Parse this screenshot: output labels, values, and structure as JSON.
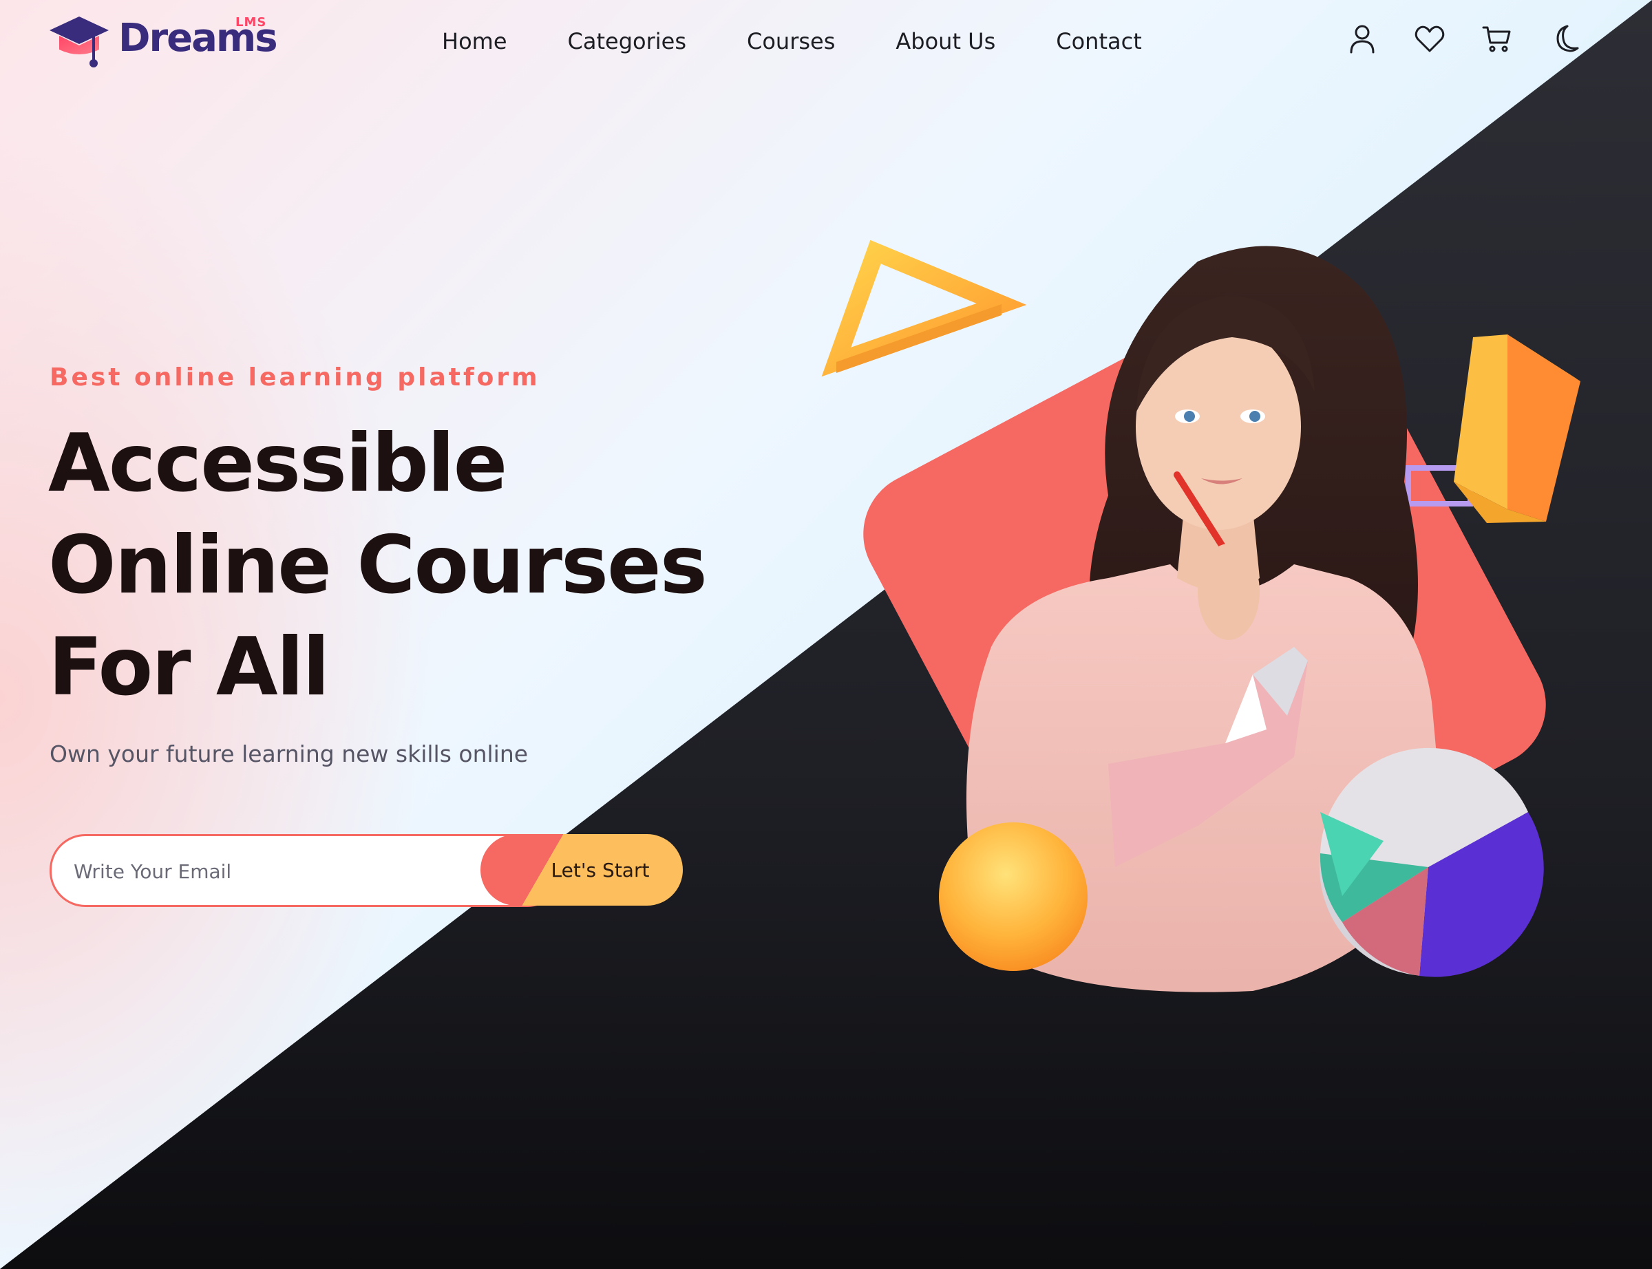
{
  "brand": {
    "name": "Dreams",
    "suffix": "LMS"
  },
  "nav": {
    "items": [
      "Home",
      "Categories",
      "Courses",
      "About Us",
      "Contact"
    ]
  },
  "header_icons": [
    "user-icon",
    "heart-icon",
    "cart-icon",
    "moon-icon"
  ],
  "hero": {
    "tagline": "Best online learning platform",
    "headline": [
      "Accessible",
      "Online Courses",
      "For All"
    ],
    "subtitle": "Own your future learning new skills online",
    "email_placeholder": "Write Your Email",
    "cta_label": "Let's Start"
  },
  "colors": {
    "brand_purple": "#392c7d",
    "accent_coral": "#f66962",
    "accent_yellow": "#fdbe5d",
    "accent_pink": "#ff4667",
    "dark_bg": "#24252b"
  }
}
